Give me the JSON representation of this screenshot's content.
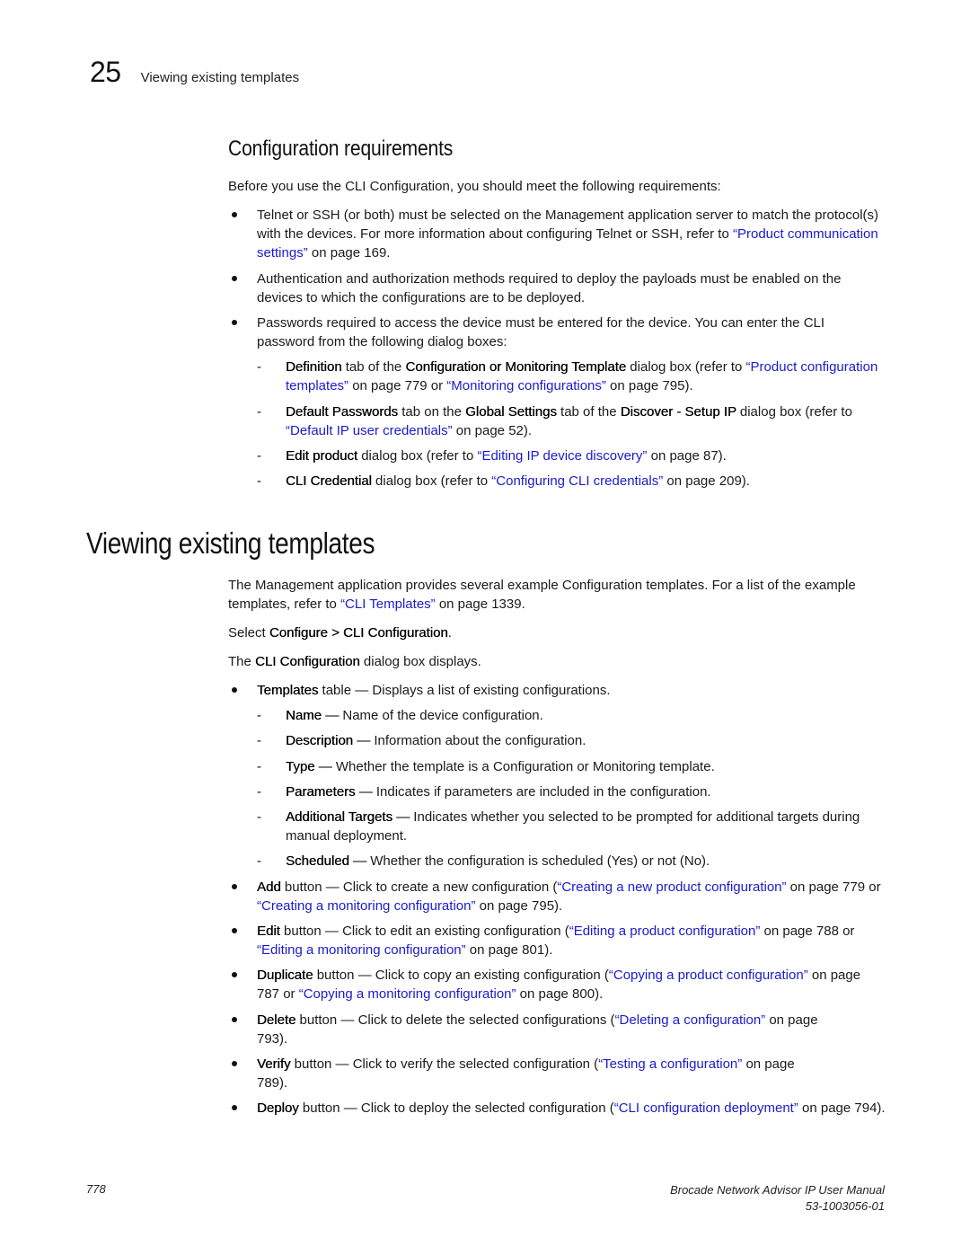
{
  "header": {
    "chapter_number": "25",
    "running_title": "Viewing existing templates"
  },
  "section_config": {
    "title": "Configuration requirements",
    "intro": "Before you use the CLI Configuration, you should meet the following requirements:",
    "bullets": [
      {
        "text1": "Telnet or SSH (or both) must be selected on the Management application server to match the protocol(s) with the devices. For more information about configuring Telnet or SSH, refer to ",
        "link": "“Product communication settings”",
        "text2": " on page 169."
      },
      {
        "text1": "Authentication and authorization methods required to deploy the payloads must be enabled on the devices to which the configurations are to be deployed."
      },
      {
        "text1": "Passwords required to access the device must be entered for the device. You can enter the CLI password from the following dialog boxes:"
      }
    ],
    "dashes": [
      {
        "b1": "Definition",
        "t1": " tab of the ",
        "b2": "Configuration or Monitoring Template",
        "t2": " dialog box (refer to ",
        "link1": "“Product configuration templates”",
        "t3": " on page 779 or ",
        "link2": "“Monitoring configurations”",
        "t4": " on page 795)."
      },
      {
        "b1": "Default Passwords",
        "t1": " tab on the ",
        "b2": "Global Settings",
        "t2": " tab of the ",
        "b3": "Discover - Setup IP",
        "t3": " dialog box (refer to ",
        "link1": "“Default IP user credentials”",
        "t4": " on page 52)."
      },
      {
        "b1": "Edit product",
        "t1": " dialog box (refer to ",
        "link1": "“Editing IP device discovery”",
        "t2": " on page 87)."
      },
      {
        "b1": "CLI Credential",
        "t1": " dialog box (refer to ",
        "link1": "“Configuring CLI credentials”",
        "t2": " on page 209)."
      }
    ]
  },
  "section_view": {
    "title": "Viewing existing templates",
    "para1": {
      "t1": "The Management application provides several example Configuration templates. For a list of the example templates, refer to ",
      "link": "“CLI Templates”",
      "t2": " on page 1339."
    },
    "para2": {
      "t1": "Select ",
      "b1": "Configure > CLI Configuration",
      "t2": "."
    },
    "para3": {
      "t1": "The ",
      "b1": "CLI Configuration",
      "t2": " dialog box displays."
    },
    "table_bullet": {
      "b1": "Templates",
      "t1": " table — Displays a list of existing configurations."
    },
    "columns": [
      {
        "name": "Name —",
        "desc": " Name of the device configuration."
      },
      {
        "name": "Description —",
        "desc": " Information about the configuration."
      },
      {
        "name": "Type —",
        "desc": " Whether the template is a Configuration or Monitoring template."
      },
      {
        "name": "Parameters —",
        "desc": " Indicates if parameters are included in the configuration."
      },
      {
        "name": "Additional Targets —",
        "desc": " Indicates whether you selected to be prompted for additional targets during manual deployment."
      },
      {
        "name": "Scheduled —",
        "desc": " Whether the configuration is scheduled (Yes) or not (No)."
      }
    ],
    "buttons": [
      {
        "name": "Add",
        "t1": " button — Click to create a new configuration (",
        "link1": "“Creating a new product configuration”",
        "t2": " on page 779 or ",
        "link2": "“Creating a monitoring configuration”",
        "t3": " on page 795)."
      },
      {
        "name": "Edit",
        "t1": " button — Click to edit an existing configuration (",
        "link1": "“Editing a product configuration”",
        "t2": " on page 788 or ",
        "link2": "“Editing a monitoring configuration”",
        "t3": " on page 801)."
      },
      {
        "name": "Duplicate",
        "t1": " button — Click to copy an existing configuration (",
        "link1": "“Copying a product configuration”",
        "t2": " on page 787 or ",
        "link2": "“Copying a monitoring configuration”",
        "t3": " on page 800)."
      },
      {
        "name": "Delete",
        "t1": " button — Click to delete the selected configurations (",
        "link1": "“Deleting a configuration”",
        "t2": " on page 793)."
      },
      {
        "name": "Verify",
        "t1": " button — Click to verify the selected configuration (",
        "link1": "“Testing a configuration”",
        "t2": " on page 789)."
      },
      {
        "name": "Deploy",
        "t1": " button — Click to deploy the selected configuration (",
        "link1": "“CLI configuration deployment”",
        "t2": " on page 794)."
      }
    ]
  },
  "footer": {
    "page_number": "778",
    "manual_title": "Brocade Network Advisor IP User Manual",
    "doc_number": "53-1003056-01"
  },
  "colors": {
    "link": "#1a1acc",
    "text": "#1a1a1a"
  }
}
